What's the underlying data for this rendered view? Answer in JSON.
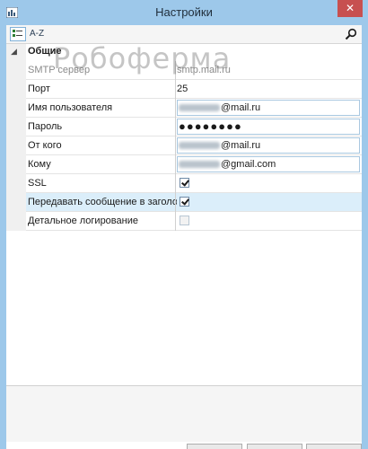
{
  "window": {
    "title": "Настройки",
    "close_glyph": "✕",
    "accent": "#9dc8ea",
    "close_color": "#c75050"
  },
  "toolbar": {
    "categorized_icon": "categorized-view-icon",
    "az_label": "A-Z",
    "search_icon": "search-icon"
  },
  "watermark": "Робоферма",
  "grid": {
    "category": {
      "label": "Общие",
      "toggle_glyph": "◢"
    },
    "properties": [
      {
        "name": "SMTP сервер",
        "value": "smtp.mail.ru",
        "type": "text",
        "disabled": true
      },
      {
        "name": "Порт",
        "value": "25",
        "type": "text",
        "disabled": false
      },
      {
        "name": "Имя пользователя",
        "value": "@mail.ru",
        "type": "email",
        "obscured_prefix": true
      },
      {
        "name": "Пароль",
        "value": "●●●●●●●●",
        "type": "password"
      },
      {
        "name": "От кого",
        "value": "@mail.ru",
        "type": "email",
        "obscured_prefix": true
      },
      {
        "name": "Кому",
        "value": "@gmail.com",
        "type": "email",
        "obscured_prefix": true
      },
      {
        "name": "SSL",
        "type": "checkbox",
        "checked": true
      },
      {
        "name": "Передавать сообщение в заголовке",
        "type": "checkbox",
        "checked": true,
        "selected": true
      },
      {
        "name": "Детальное логирование",
        "type": "checkbox",
        "checked": false,
        "disabled": true
      }
    ]
  }
}
